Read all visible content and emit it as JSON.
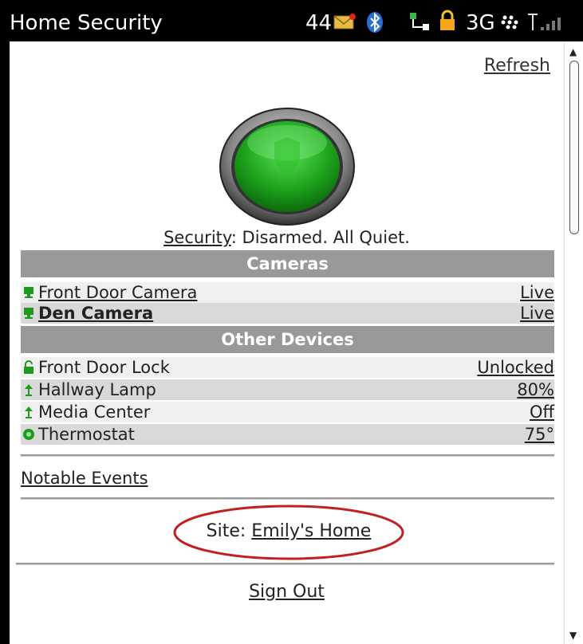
{
  "status_bar": {
    "app_title": "Home Security",
    "notification_count": "44",
    "network_type": "3G",
    "icons": [
      "mail-icon",
      "bluetooth-icon",
      "data-transfer-icon",
      "lock-icon",
      "blackberry-icon",
      "signal-strength-icon"
    ]
  },
  "header": {
    "refresh_label": "Refresh"
  },
  "security": {
    "label": "Security",
    "status_text": ": Disarmed. All Quiet.",
    "orb_color": "#21a51f",
    "icon": "shield-icon"
  },
  "cameras": {
    "heading": "Cameras",
    "items": [
      {
        "name": "Front Door Camera",
        "value": "Live",
        "icon": "camera-icon"
      },
      {
        "name": "Den Camera",
        "value": "Live",
        "icon": "camera-icon"
      }
    ]
  },
  "devices": {
    "heading": "Other Devices",
    "items": [
      {
        "name": "Front Door Lock",
        "value": "Unlocked",
        "icon": "unlock-icon"
      },
      {
        "name": "Hallway Lamp",
        "value": "80%",
        "icon": "lamp-icon"
      },
      {
        "name": "Media Center",
        "value": "Off",
        "icon": "lamp-icon"
      },
      {
        "name": "Thermostat",
        "value": "75°",
        "icon": "thermostat-icon"
      }
    ]
  },
  "events_link": "Notable Events",
  "site": {
    "label": "Site: ",
    "name": "Emily's Home",
    "highlight_color": "#c21f1f"
  },
  "sign_out_label": "Sign Out",
  "colors": {
    "section_header": "#999999",
    "icon_green": "#1f9a1f"
  }
}
